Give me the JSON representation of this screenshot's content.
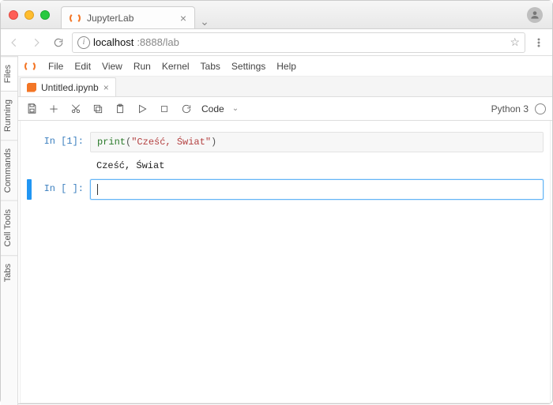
{
  "browser": {
    "tab_title": "JupyterLab",
    "url_host": "localhost",
    "url_port_path": ":8888/lab"
  },
  "menubar": {
    "items": [
      "File",
      "Edit",
      "View",
      "Run",
      "Kernel",
      "Tabs",
      "Settings",
      "Help"
    ]
  },
  "left_tabs": [
    "Files",
    "Running",
    "Commands",
    "Cell Tools",
    "Tabs"
  ],
  "doc_tab": {
    "name": "Untitled.ipynb"
  },
  "toolbar": {
    "cell_type": "Code",
    "kernel": "Python 3"
  },
  "cells": [
    {
      "prompt": "In [1]:",
      "code_tokens": [
        {
          "t": "print",
          "c": "tok-fn"
        },
        {
          "t": "(",
          "c": "tok-punc"
        },
        {
          "t": "\"Cześć, Świat\"",
          "c": "tok-str"
        },
        {
          "t": ")",
          "c": "tok-punc"
        }
      ],
      "output": "Cześć, Świat",
      "active": false
    },
    {
      "prompt": "In [ ]:",
      "code_tokens": [],
      "output": null,
      "active": true
    }
  ]
}
